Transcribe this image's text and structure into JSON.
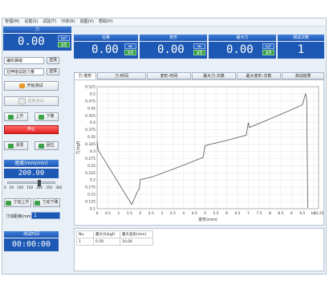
{
  "menu": [
    "管理(M)",
    "设置(S)",
    "试验(T)",
    "印单(R)",
    "视图(V)",
    "帮助(H)"
  ],
  "panels": {
    "force": {
      "title": "力",
      "value": "0.00",
      "unit": "kgf",
      "reset": "清零"
    },
    "position": {
      "title": "位移",
      "value": "0.00",
      "unit": "mm",
      "reset": "清零"
    },
    "deformation": {
      "title": "变形",
      "value": "0.00",
      "unit": "mm",
      "reset": "清零"
    },
    "max_force": {
      "title": "最大力",
      "value": "0.00",
      "unit": "kgf",
      "reset": "清零"
    },
    "test_count": {
      "title": "测试次数",
      "value": "1"
    }
  },
  "left": {
    "test_type": "编织袋缝",
    "test_method": "拉伸值试验力量",
    "other_btn": "选择",
    "start_btn": "开始测试",
    "stop_btn": "结束测试",
    "up_btn": "上升",
    "down_btn": "下降",
    "halt_btn": "停止",
    "clear_btn": "清零",
    "return_btn": "回位",
    "speed_label": "速度(mm/min)",
    "speed_value": "200.00",
    "speed_ticks": [
      "0",
      "50",
      "100",
      "150",
      "200",
      "250",
      "300"
    ],
    "speed_level": 0.667,
    "jog_up": "寸动上升",
    "jog_down": "寸动下降",
    "jog_distance_label": "寸动距离(mm)",
    "jog_distance_value": "1",
    "timer_label": "测试时间",
    "timer_value": "00:00:00"
  },
  "tabs": [
    "力-变形",
    "力-时间",
    "变形-时间",
    "最大力-次数",
    "最大变形-次数",
    "测试结果"
  ],
  "chart_data": {
    "type": "line",
    "xlabel": "变形(mm)",
    "ylabel": "力(kgf)",
    "xlim": [
      0,
      10.25
    ],
    "ylim": [
      0.1,
      0.525
    ],
    "x_ticks": [
      "0",
      "0.5",
      "1",
      "1.5",
      "2",
      "2.5",
      "3",
      "3.5",
      "4",
      "4.5",
      "5",
      "5.5",
      "6",
      "6.5",
      "7",
      "7.5",
      "8",
      "8.5",
      "9",
      "9.5",
      "10",
      "10.25"
    ],
    "y_ticks": [
      "0.1",
      "0.125",
      "0.15",
      "0.175",
      "0.2",
      "0.225",
      "0.25",
      "0.275",
      "0.3",
      "0.325",
      "0.35",
      "0.375",
      "0.4",
      "0.425",
      "0.45",
      "0.475",
      "0.5",
      "0.525"
    ],
    "grid": true,
    "series": [
      {
        "color": "#555555",
        "x": [
          0,
          0.05,
          1.6,
          1.9,
          1.95,
          2.0,
          2.1,
          2.6,
          3.1,
          3.6,
          4.1,
          4.6,
          4.9,
          4.95,
          5.0,
          6.0,
          6.9,
          7.0,
          7.05,
          8.0,
          9.0,
          9.5,
          9.65,
          9.7,
          9.75
        ],
        "y": [
          0.335,
          0.305,
          0.115,
          0.165,
          0.17,
          0.202,
          0.203,
          0.212,
          0.226,
          0.24,
          0.255,
          0.27,
          0.278,
          0.3,
          0.32,
          0.338,
          0.356,
          0.4,
          0.383,
          0.413,
          0.445,
          0.462,
          0.5,
          0.485,
          0.103
        ]
      }
    ]
  },
  "results": {
    "headers": [
      "No.",
      "最大力(kgf)",
      "最大变形(mm)"
    ],
    "rows": [
      [
        "1",
        "0.50",
        "10.00"
      ]
    ]
  }
}
